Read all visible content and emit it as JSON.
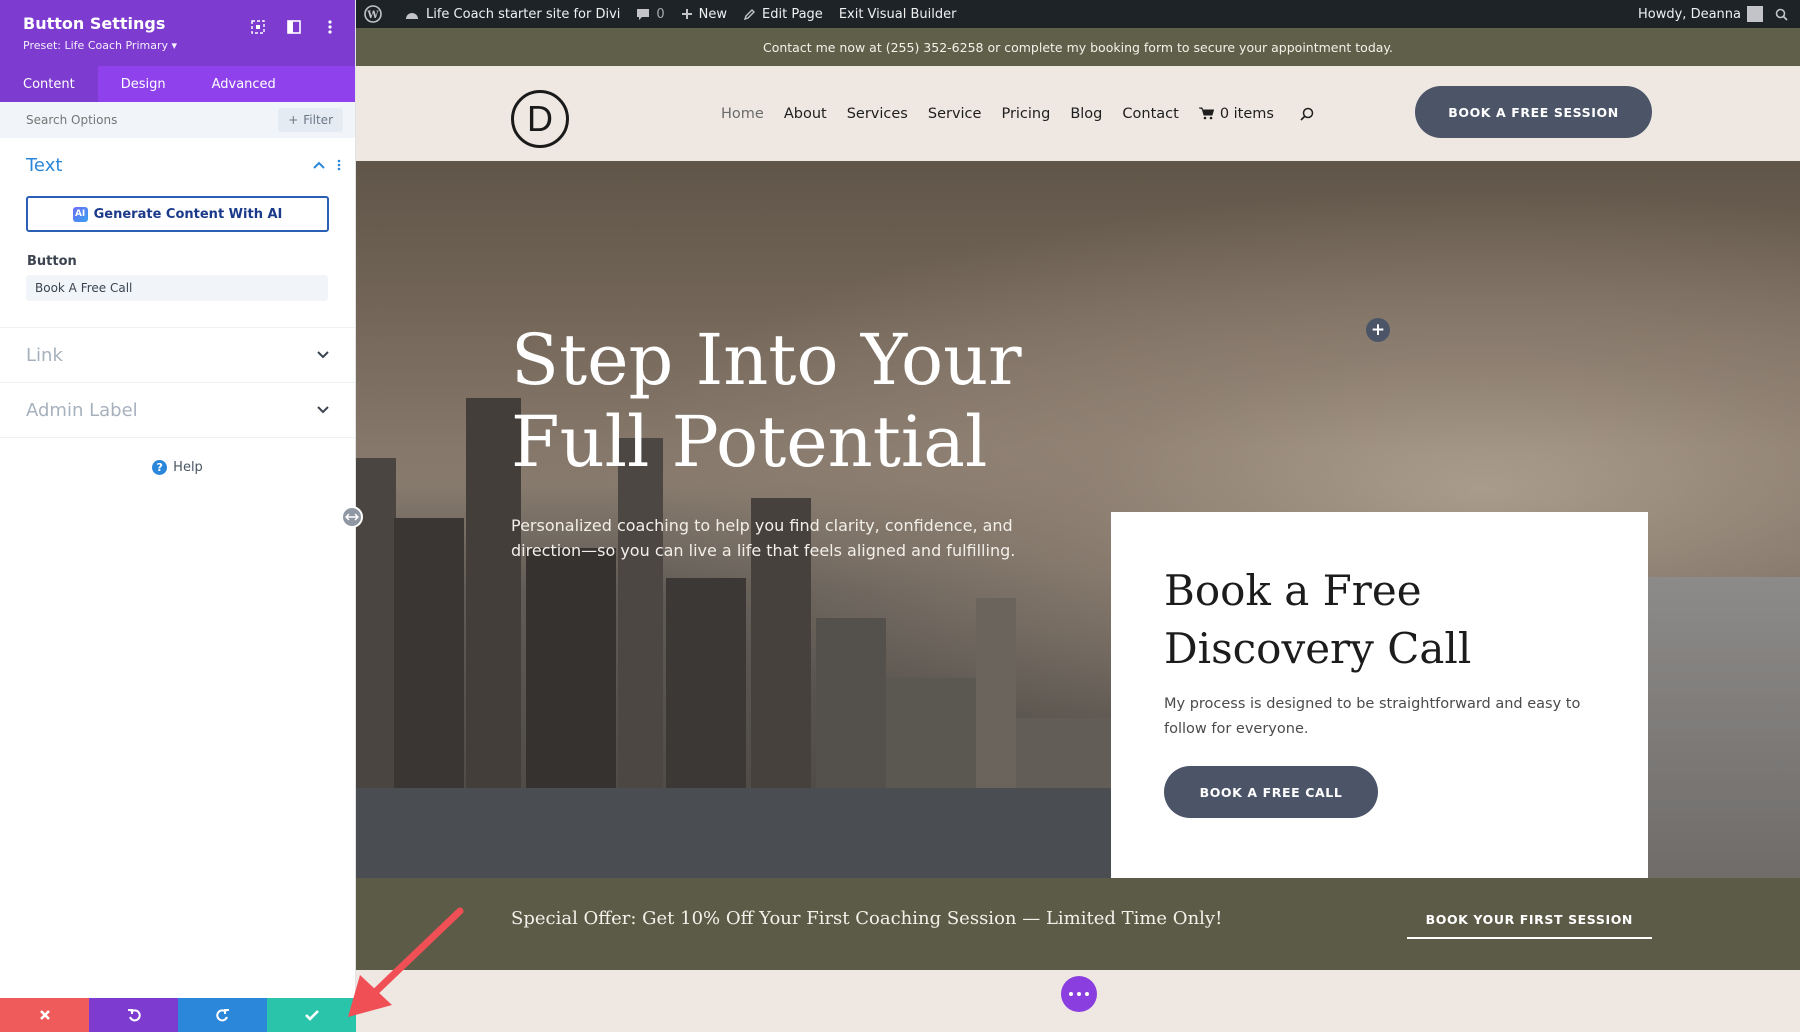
{
  "admin_bar": {
    "site_name": "Life Coach starter site for Divi",
    "comments_count": "0",
    "new_label": "New",
    "edit_label": "Edit Page",
    "exit_label": "Exit Visual Builder",
    "howdy": "Howdy, Deanna",
    "bg_color": "#1d2327"
  },
  "panel": {
    "title": "Button Settings",
    "preset": "Preset: Life Coach Primary ▾",
    "tabs": [
      "Content",
      "Design",
      "Advanced"
    ],
    "active_tab": "Content",
    "search_placeholder": "Search Options",
    "filter_label": "Filter",
    "sections": {
      "text": "Text",
      "link": "Link",
      "admin_label": "Admin Label"
    },
    "ai_button": "Generate Content With AI",
    "ai_badge": "AI",
    "button_field_label": "Button",
    "button_field_value": "Book A Free Call",
    "help": "Help",
    "accent_color": "#7e3bd0",
    "bottom_bar_colors": [
      "#ef5a5a",
      "#7e3bd0",
      "#2b87da",
      "#29c4a9"
    ]
  },
  "site": {
    "topbar_text": "Contact me now at (255) 352-6258 or complete my booking form to secure your appointment today.",
    "logo_letter": "D",
    "nav": [
      "Home",
      "About",
      "Services",
      "Service",
      "Pricing",
      "Blog",
      "Contact"
    ],
    "cart_label": "0 items",
    "header_button": "BOOK A FREE SESSION",
    "hero": {
      "title_line1": "Step Into Your",
      "title_line2": "Full Potential",
      "subtitle": "Personalized coaching to help you find clarity, confidence, and direction—so you can live a life that feels aligned and fulfilling."
    },
    "card": {
      "title": "Book a Free Discovery Call",
      "text": "My process is designed to be straightforward and easy to follow for everyone.",
      "button": "BOOK A FREE CALL"
    },
    "offer": {
      "text": "Special Offer: Get 10% Off Your First Coaching Session — Limited Time Only!",
      "button": "BOOK YOUR FIRST SESSION"
    },
    "button_color": "#4c5568",
    "offer_bg": "#5c5b47"
  }
}
